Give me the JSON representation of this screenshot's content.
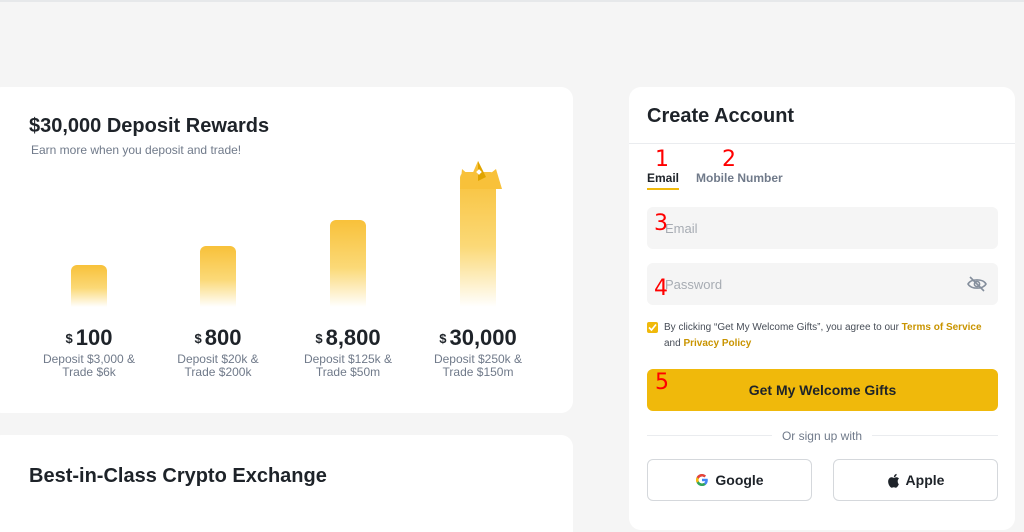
{
  "rewards": {
    "title": "$30,000 Deposit Rewards",
    "subtitle": "Earn more when you deposit and trade!",
    "currency": "$",
    "tiers": [
      {
        "amount": "100",
        "desc_line1": "Deposit $3,000 &",
        "desc_line2": "Trade $6k"
      },
      {
        "amount": "800",
        "desc_line1": "Deposit $20k &",
        "desc_line2": "Trade $200k"
      },
      {
        "amount": "8,800",
        "desc_line1": "Deposit $125k &",
        "desc_line2": "Trade $50m"
      },
      {
        "amount": "30,000",
        "desc_line1": "Deposit $250k &",
        "desc_line2": "Trade $150m"
      }
    ]
  },
  "exchange": {
    "title": "Best-in-Class Crypto Exchange"
  },
  "signup": {
    "title": "Create Account",
    "tabs": [
      {
        "label": "Email",
        "active": true
      },
      {
        "label": "Mobile Number",
        "active": false
      }
    ],
    "email_placeholder": "Email",
    "password_placeholder": "Password",
    "terms_prefix": "By clicking “Get My Welcome Gifts”, you agree to our ",
    "terms_link": "Terms of Service",
    "terms_and": "and ",
    "privacy_link": "Privacy Policy",
    "cta_label": "Get My Welcome Gifts",
    "or_text": "Or sign up with",
    "google_label": "Google",
    "apple_label": "Apple"
  },
  "colors": {
    "accent": "#f0b90b",
    "link": "#c99400",
    "bar_top": "#f8c13a",
    "marker": "#ff0000"
  },
  "icons": [
    "eye-off-icon",
    "check-icon",
    "google-icon",
    "apple-icon",
    "crown-icon"
  ],
  "markers": [
    "1",
    "2",
    "3",
    "4",
    "5"
  ]
}
